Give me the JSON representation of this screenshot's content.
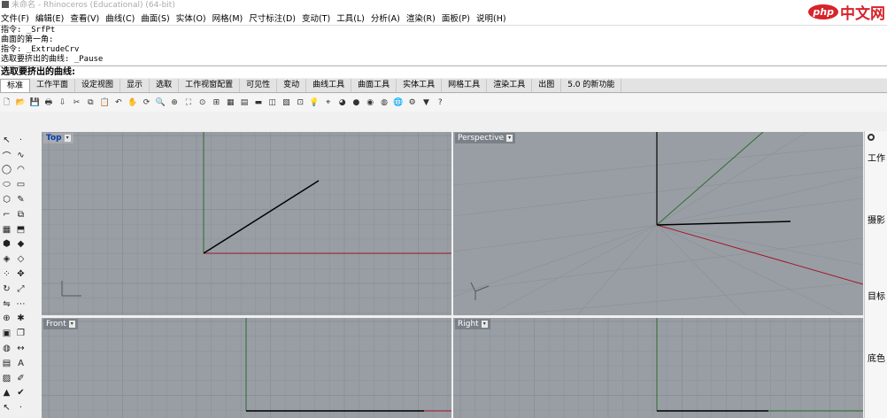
{
  "window": {
    "title": "未命名 - Rhinoceros (Educational) (64-bit)"
  },
  "watermark": {
    "badge": "php",
    "text": "中文网"
  },
  "menu": [
    "文件(F)",
    "编辑(E)",
    "查看(V)",
    "曲线(C)",
    "曲面(S)",
    "实体(O)",
    "网格(M)",
    "尺寸标注(D)",
    "变动(T)",
    "工具(L)",
    "分析(A)",
    "渲染(R)",
    "面板(P)",
    "说明(H)"
  ],
  "command_history": [
    "指令: _SrfPt",
    "曲面的第一角:",
    "指令: _ExtrudeCrv",
    "选取要挤出的曲线: _Pause"
  ],
  "command_prompt": "选取要挤出的曲线:",
  "tabs": [
    "标准",
    "工作平面",
    "设定视图",
    "显示",
    "选取",
    "工作视窗配置",
    "可见性",
    "变动",
    "曲线工具",
    "曲面工具",
    "实体工具",
    "网格工具",
    "渲染工具",
    "出图",
    "5.0 的新功能"
  ],
  "active_tab": "标准",
  "toolbar_icons": [
    "new-file-icon",
    "open-file-icon",
    "save-icon",
    "print-icon",
    "import-icon",
    "cut-icon",
    "copy-icon",
    "paste-icon",
    "undo-icon",
    "pan-hand-icon",
    "rotate-view-icon",
    "zoom-dynamic-icon",
    "zoom-window-icon",
    "zoom-extents-icon",
    "zoom-selected-icon",
    "zoom-all-icon",
    "four-views-icon",
    "layout-grid-icon",
    "tools-red-icon",
    "layer-icon",
    "properties-icon",
    "cplane-icon",
    "light-icon",
    "object-snap-icon",
    "render-icon",
    "render-sphere-icon",
    "material-sphere-icon",
    "environment-icon",
    "blue-sphere-icon",
    "options-icon",
    "filter-icon",
    "help-icon"
  ],
  "left_tools": [
    [
      "select-arrow-icon",
      "point-icon"
    ],
    [
      "polyline-icon",
      "curve-icon"
    ],
    [
      "circle-icon",
      "arc-icon"
    ],
    [
      "ellipse-icon",
      "rectangle-icon"
    ],
    [
      "polygon-icon",
      "freeform-icon"
    ],
    [
      "fillet-curve-icon",
      "curve-offset-icon"
    ],
    [
      "surface-icon",
      "extrude-icon"
    ],
    [
      "box-icon",
      "solid-edit-icon"
    ],
    [
      "boolean-union-icon",
      "boolean-icon"
    ],
    [
      "mesh-icon",
      "mesh-edit-icon"
    ],
    [
      "point-cloud-icon",
      "move-icon"
    ],
    [
      "rotate-icon",
      "scale-icon"
    ],
    [
      "mirror-icon",
      "array-icon"
    ],
    [
      "join-icon",
      "explode-icon"
    ],
    [
      "group-icon",
      "block-icon"
    ],
    [
      "sphere-icon",
      "dimension-icon"
    ],
    [
      "table-icon",
      "text-icon"
    ],
    [
      "hatch-icon",
      "annotation-icon"
    ],
    [
      "cone-icon",
      "check-icon"
    ]
  ],
  "viewports": [
    {
      "name": "Top",
      "active": true
    },
    {
      "name": "Perspective",
      "active": false
    },
    {
      "name": "Front",
      "active": false
    },
    {
      "name": "Right",
      "active": false
    }
  ],
  "right_panel": {
    "labels": [
      "工作",
      "摄影",
      "目标",
      "底色"
    ]
  },
  "colors": {
    "viewport_bg": "#999ea4",
    "grid_line": "#8a9096",
    "x_axis": "#a01a2b",
    "y_axis": "#2e6b2e",
    "curve": "#000000",
    "active_title": "#0a3fa8"
  }
}
